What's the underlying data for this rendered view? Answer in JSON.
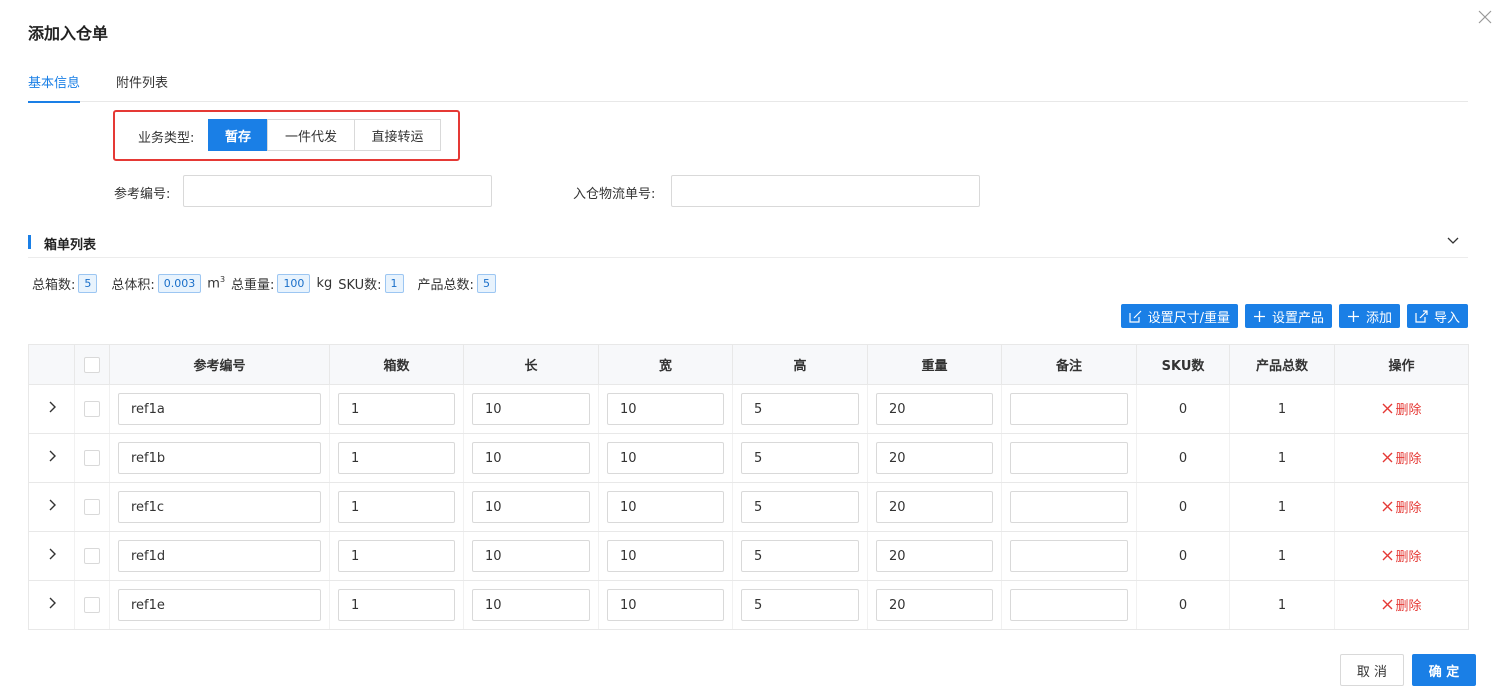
{
  "modal": {
    "title": "添加入仓单"
  },
  "tabs": [
    {
      "label": "基本信息",
      "active": true
    },
    {
      "label": "附件列表",
      "active": false
    }
  ],
  "business_type": {
    "label": "业务类型:",
    "options": [
      "暂存",
      "一件代发",
      "直接转运"
    ],
    "selected": "暂存"
  },
  "fields": {
    "reference_no": {
      "label": "参考编号:",
      "value": ""
    },
    "inbound_tracking_no": {
      "label": "入仓物流单号:",
      "value": ""
    }
  },
  "section": {
    "title": "箱单列表"
  },
  "stats": {
    "total_boxes": {
      "label": "总箱数:",
      "value": "5"
    },
    "total_volume": {
      "label": "总体积:",
      "value": "0.003",
      "unit": "m",
      "unit_sup": "3"
    },
    "total_weight": {
      "label": "总重量:",
      "value": "100",
      "unit": "kg"
    },
    "sku_count": {
      "label": "SKU数:",
      "value": "1"
    },
    "total_products": {
      "label": "产品总数:",
      "value": "5"
    }
  },
  "toolbar": {
    "set_dimensions": "设置尺寸/重量",
    "set_products": "设置产品",
    "add": "添加",
    "import": "导入"
  },
  "table": {
    "headers": [
      "参考编号",
      "箱数",
      "长",
      "宽",
      "高",
      "重量",
      "备注",
      "SKU数",
      "产品总数",
      "操作"
    ],
    "delete_label": "删除",
    "rows": [
      {
        "ref": "ref1a",
        "boxes": "1",
        "length": "10",
        "width": "10",
        "height": "5",
        "weight": "20",
        "note": "",
        "sku": "0",
        "products": "1"
      },
      {
        "ref": "ref1b",
        "boxes": "1",
        "length": "10",
        "width": "10",
        "height": "5",
        "weight": "20",
        "note": "",
        "sku": "0",
        "products": "1"
      },
      {
        "ref": "ref1c",
        "boxes": "1",
        "length": "10",
        "width": "10",
        "height": "5",
        "weight": "20",
        "note": "",
        "sku": "0",
        "products": "1"
      },
      {
        "ref": "ref1d",
        "boxes": "1",
        "length": "10",
        "width": "10",
        "height": "5",
        "weight": "20",
        "note": "",
        "sku": "0",
        "products": "1"
      },
      {
        "ref": "ref1e",
        "boxes": "1",
        "length": "10",
        "width": "10",
        "height": "5",
        "weight": "20",
        "note": "",
        "sku": "0",
        "products": "1"
      }
    ]
  },
  "footer": {
    "cancel": "取 消",
    "confirm": "确 定"
  },
  "colors": {
    "primary": "#1a7fe6",
    "danger": "#e53935",
    "highlight_box": "#e53935"
  }
}
